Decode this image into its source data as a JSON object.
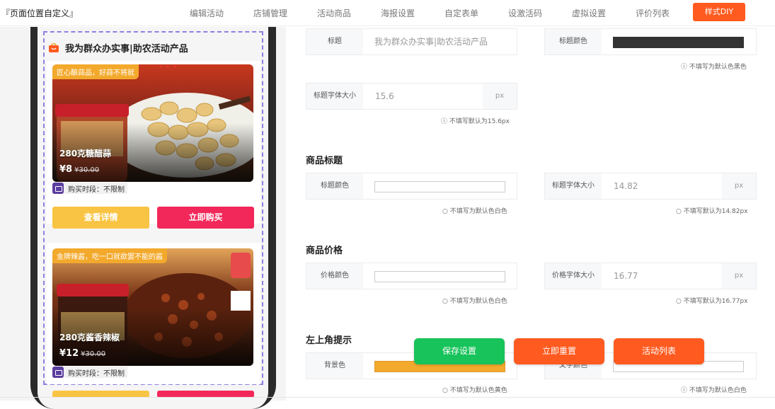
{
  "header": {
    "brand": "『页面位置自定义』",
    "nav": [
      "编辑活动",
      "店铺管理",
      "活动商品",
      "海报设置",
      "自定表单",
      "设激活码",
      "虚拟设置",
      "评价列表"
    ],
    "diy_button": "样式DIY"
  },
  "preview": {
    "shop_title": "我为群众办实事|助农活动产品",
    "products": [
      {
        "tag": "匠心酿蒜品，好蒜不将就",
        "name": "280克糖醋蒜",
        "price": "¥8",
        "old_price": "¥30.00",
        "buy_time": "购买时段：不限制",
        "detail_label": "查看详情",
        "buy_label": "立即购买"
      },
      {
        "tag": "金牌辣酱，吃一口就欲罢不能的酱",
        "name": "280克酱香辣椒",
        "price": "¥12",
        "old_price": "¥30.00",
        "buy_time": "购买时段：不限制"
      }
    ]
  },
  "form": {
    "title": {
      "label": "标题",
      "placeholder": "我为群众办实事|助农活动产品",
      "color_label": "标题颜色",
      "color_value": "#333333",
      "color_hint": "不填写为默认色黑色",
      "size_label": "标题字体大小",
      "size_value": "15.6",
      "size_unit": "px",
      "size_hint": "不填写默认为15.6px"
    },
    "product_title": {
      "section": "商品标题",
      "color_label": "标题颜色",
      "color_value": "#ffffff",
      "color_hint": "不填写为默认色白色",
      "size_label": "标题字体大小",
      "size_value": "14.82",
      "size_unit": "px",
      "size_hint": "不填写默认为14.82px"
    },
    "product_price": {
      "section": "商品价格",
      "color_label": "价格颜色",
      "color_value": "#ffffff",
      "color_hint": "不填写为默认色白色",
      "size_label": "价格字体大小",
      "size_value": "16.77",
      "size_unit": "px",
      "size_hint": "不填写默认为16.77px"
    },
    "corner_tip": {
      "section": "左上角提示",
      "bg_label": "背景色",
      "bg_value": "#f3a92c",
      "bg_hint": "不填写为默认色黄色",
      "text_label": "文字颜色",
      "text_value": "#ffffff",
      "text_hint": "不填写为默认色白色"
    }
  },
  "actions": {
    "save": "保存设置",
    "reset": "立即重置",
    "list": "活动列表"
  },
  "colors": {
    "accent_orange": "#ff5a1f",
    "save_green": "#17c35a",
    "dashed_border": "#8f7fe0",
    "tag_yellow": "#f3a92c",
    "detail_yellow": "#f9c443",
    "buy_red": "#f2285a"
  }
}
